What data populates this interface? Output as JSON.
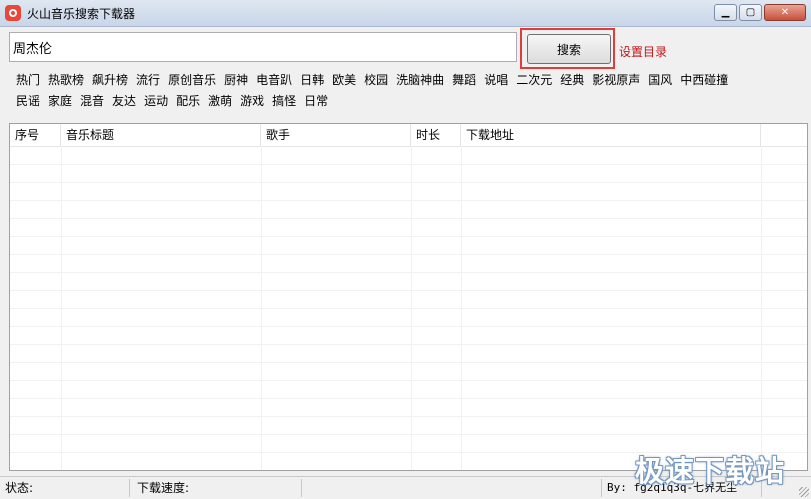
{
  "window": {
    "title": "火山音乐搜索下载器",
    "minimize_glyph": "▁",
    "maximize_glyph": "▢",
    "close_glyph": "✕"
  },
  "search": {
    "query": "周杰伦",
    "button_label": "搜索",
    "set_dir_label": "设置目录"
  },
  "categories": {
    "row1": [
      "热门",
      "热歌榜",
      "飙升榜",
      "流行",
      "原创音乐",
      "厨神",
      "电音趴",
      "日韩",
      "欧美",
      "校园",
      "洗脑神曲",
      "舞蹈",
      "说唱",
      "二次元",
      "经典",
      "影视原声",
      "国风",
      "中西碰撞"
    ],
    "row2": [
      "民谣",
      "家庭",
      "混音",
      "友达",
      "运动",
      "配乐",
      "激萌",
      "游戏",
      "搞怪",
      "日常"
    ]
  },
  "table": {
    "columns": [
      "序号",
      "音乐标题",
      "歌手",
      "时长",
      "下载地址"
    ],
    "rows": []
  },
  "status": {
    "status_label": "状态:",
    "speed_label": "下载速度:",
    "credit": "By: fg2q1q3q-七界无尘"
  },
  "watermark": "极速下载站",
  "colors": {
    "highlight_border": "#e03c3c",
    "set_dir_text": "#c0161b"
  }
}
